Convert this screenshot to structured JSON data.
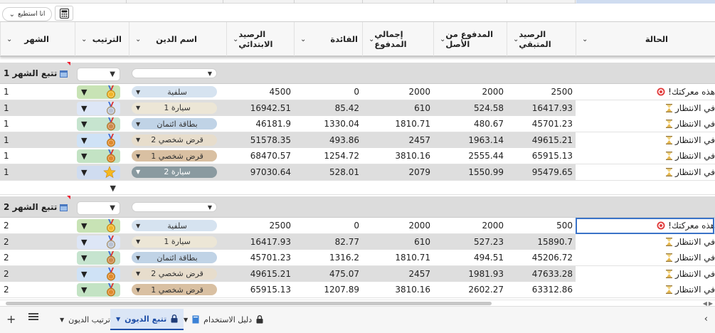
{
  "toolbar": {
    "cant_label": "انا استطيع",
    "calculator_icon": "calculator-icon"
  },
  "headers": [
    {
      "key": "month",
      "label": "الشهر"
    },
    {
      "key": "rank",
      "label": "الترتيب"
    },
    {
      "key": "debt_name",
      "label": "اسم الدين"
    },
    {
      "key": "initial",
      "label": "الرصيد الابتدائي"
    },
    {
      "key": "interest",
      "label": "الفائدة"
    },
    {
      "key": "total_paid",
      "label": "إجمالي المدفوع"
    },
    {
      "key": "principal_paid",
      "label": "المدفوع من الأصل"
    },
    {
      "key": "remaining",
      "label": "الرصيد المتبقي"
    },
    {
      "key": "status",
      "label": "الحالة"
    }
  ],
  "groups": [
    {
      "label": "تتبع الشهر 1",
      "rows": [
        {
          "month": "1",
          "rank_icon": "medal-1-icon",
          "rank_color": "#c8e3b5",
          "debt_name": "سلفية",
          "chip_color": "#d6e3f0",
          "initial": "4500",
          "interest": "0",
          "total_paid": "2000",
          "principal_paid": "2000",
          "remaining": "2500",
          "status": "هذه معركتك!",
          "status_icon": "target-icon"
        },
        {
          "month": "1",
          "rank_icon": "medal-2-icon",
          "rank_color": "#dde6f6",
          "debt_name": "سيارة 1",
          "chip_color": "#ece6d6",
          "initial": "16942.51",
          "interest": "85.42",
          "total_paid": "610",
          "principal_paid": "524.58",
          "remaining": "16417.93",
          "status": "في الانتظار",
          "status_icon": "hourglass-icon"
        },
        {
          "month": "1",
          "rank_icon": "medal-3-icon",
          "rank_color": "#c6e4cf",
          "debt_name": "بطاقة ائتمان",
          "chip_color": "#c0d3e6",
          "initial": "46181.9",
          "interest": "1330.04",
          "total_paid": "1810.71",
          "principal_paid": "480.67",
          "remaining": "45701.23",
          "status": "في الانتظار",
          "status_icon": "hourglass-icon"
        },
        {
          "month": "1",
          "rank_icon": "medal-4-icon",
          "rank_color": "#cfe2f6",
          "debt_name": "قرض شخصي 2",
          "chip_color": "#e7ddcc",
          "initial": "51578.35",
          "interest": "493.86",
          "total_paid": "2457",
          "principal_paid": "1963.14",
          "remaining": "49615.21",
          "status": "في الانتظار",
          "status_icon": "hourglass-icon"
        },
        {
          "month": "1",
          "rank_icon": "medal-5-icon",
          "rank_color": "#c3e3c4",
          "debt_name": "قرض شخصي 1",
          "chip_color": "#d9c0a2",
          "initial": "68470.57",
          "interest": "1254.72",
          "total_paid": "3810.16",
          "principal_paid": "2555.44",
          "remaining": "65915.13",
          "status": "في الانتظار",
          "status_icon": "hourglass-icon"
        },
        {
          "month": "1",
          "rank_icon": "star-icon",
          "rank_color": "#cfdcf0",
          "debt_name": "سيارة 2",
          "chip_color": "#8a9aa0",
          "initial": "97030.64",
          "interest": "528.01",
          "total_paid": "2079",
          "principal_paid": "1550.99",
          "remaining": "95479.65",
          "status": "في الانتظار",
          "status_icon": "hourglass-icon"
        }
      ]
    },
    {
      "label": "تتبع الشهر 2",
      "rows": [
        {
          "month": "2",
          "rank_icon": "medal-1-icon",
          "rank_color": "#c8e3b5",
          "debt_name": "سلفية",
          "chip_color": "#d6e3f0",
          "initial": "2500",
          "interest": "0",
          "total_paid": "2000",
          "principal_paid": "2000",
          "remaining": "500",
          "status": "هذه معركتك!",
          "status_icon": "target-icon"
        },
        {
          "month": "2",
          "rank_icon": "medal-2-icon",
          "rank_color": "#dde6f6",
          "debt_name": "سيارة 1",
          "chip_color": "#ece6d6",
          "initial": "16417.93",
          "interest": "82.77",
          "total_paid": "610",
          "principal_paid": "527.23",
          "remaining": "15890.7",
          "status": "في الانتظار",
          "status_icon": "hourglass-icon"
        },
        {
          "month": "2",
          "rank_icon": "medal-3-icon",
          "rank_color": "#c6e4cf",
          "debt_name": "بطاقة ائتمان",
          "chip_color": "#c0d3e6",
          "initial": "45701.23",
          "interest": "1316.2",
          "total_paid": "1810.71",
          "principal_paid": "494.51",
          "remaining": "45206.72",
          "status": "في الانتظار",
          "status_icon": "hourglass-icon"
        },
        {
          "month": "2",
          "rank_icon": "medal-4-icon",
          "rank_color": "#cfe2f6",
          "debt_name": "قرض شخصي 2",
          "chip_color": "#e7ddcc",
          "initial": "49615.21",
          "interest": "475.07",
          "total_paid": "2457",
          "principal_paid": "1981.93",
          "remaining": "47633.28",
          "status": "في الانتظار",
          "status_icon": "hourglass-icon"
        },
        {
          "month": "2",
          "rank_icon": "medal-5-icon",
          "rank_color": "#c3e3c4",
          "debt_name": "قرض شخصي 1",
          "chip_color": "#d9c0a2",
          "initial": "65915.13",
          "interest": "1207.89",
          "total_paid": "3810.16",
          "principal_paid": "2602.27",
          "remaining": "63312.86",
          "status": "في الانتظار",
          "status_icon": "hourglass-icon"
        }
      ]
    }
  ],
  "tabs": [
    {
      "label": "ترتيب الديون",
      "active": false,
      "icon": ""
    },
    {
      "label": "تتبع الديون",
      "active": true,
      "icon": "lock-icon"
    },
    {
      "label": "دليل الاستخدام",
      "active": false,
      "icon": "lock-icon"
    }
  ],
  "tab_book_icon": "book-icon",
  "bottom": {
    "add_sheet": "+",
    "all_sheets_icon": "hamburger-icon",
    "nav_icon": "chevron-left-icon"
  }
}
